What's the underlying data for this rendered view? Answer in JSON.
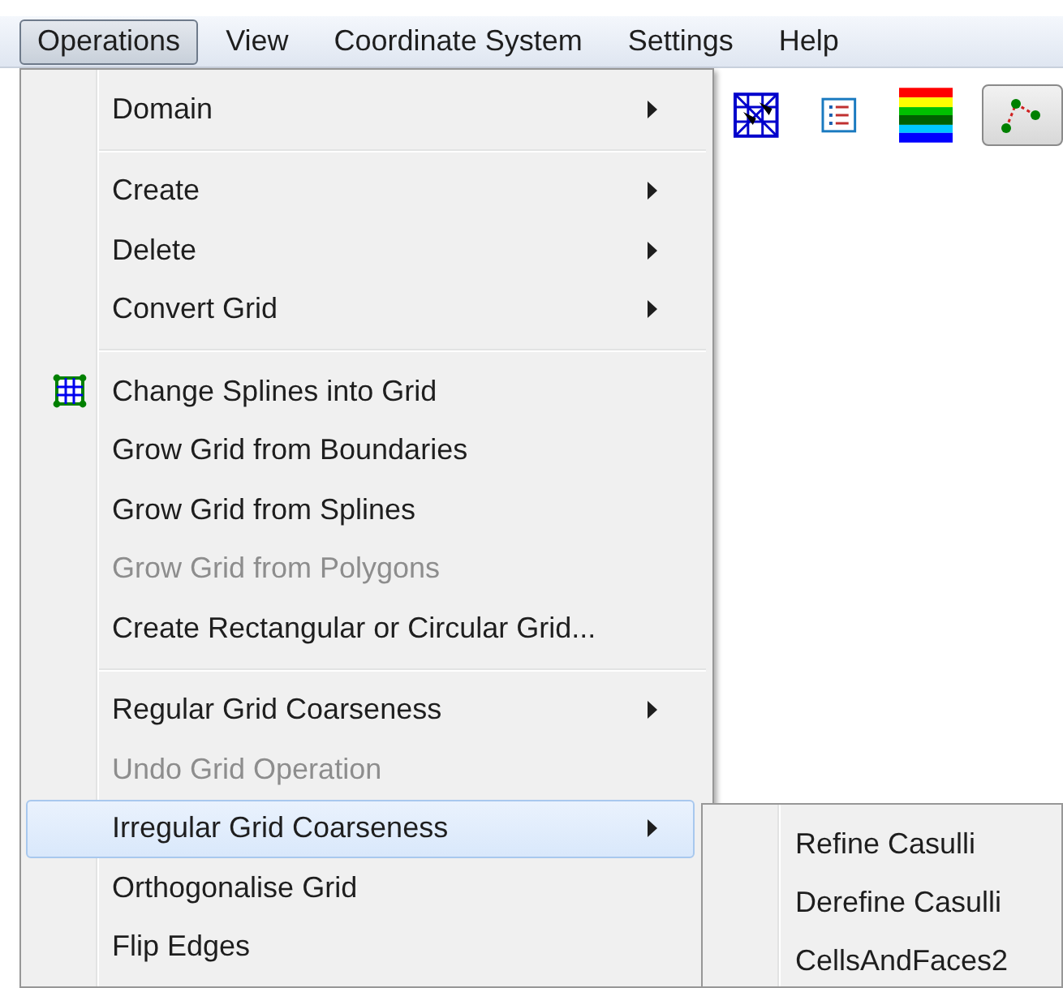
{
  "menubar": [
    {
      "label": "Operations",
      "selected": true
    },
    {
      "label": "View",
      "selected": false
    },
    {
      "label": "Coordinate System",
      "selected": false
    },
    {
      "label": "Settings",
      "selected": false
    },
    {
      "label": "Help",
      "selected": false
    }
  ],
  "menu": [
    {
      "kind": "item",
      "label": "Domain",
      "submenu_arrow": true,
      "disabled": false,
      "selected": false,
      "has_icon": false
    },
    {
      "kind": "separator"
    },
    {
      "kind": "item",
      "label": "Create",
      "submenu_arrow": true,
      "disabled": false,
      "selected": false,
      "has_icon": false
    },
    {
      "kind": "item",
      "label": "Delete",
      "submenu_arrow": true,
      "disabled": false,
      "selected": false,
      "has_icon": false
    },
    {
      "kind": "item",
      "label": "Convert Grid",
      "submenu_arrow": true,
      "disabled": false,
      "selected": false,
      "has_icon": false
    },
    {
      "kind": "separator"
    },
    {
      "kind": "item",
      "label": "Change Splines into Grid",
      "submenu_arrow": false,
      "disabled": false,
      "selected": false,
      "has_icon": true
    },
    {
      "kind": "item",
      "label": "Grow Grid from Boundaries",
      "submenu_arrow": false,
      "disabled": false,
      "selected": false,
      "has_icon": false
    },
    {
      "kind": "item",
      "label": "Grow Grid from Splines",
      "submenu_arrow": false,
      "disabled": false,
      "selected": false,
      "has_icon": false
    },
    {
      "kind": "item",
      "label": "Grow Grid from Polygons",
      "submenu_arrow": false,
      "disabled": true,
      "selected": false,
      "has_icon": false
    },
    {
      "kind": "item",
      "label": "Create Rectangular or Circular Grid...",
      "submenu_arrow": false,
      "disabled": false,
      "selected": false,
      "has_icon": false
    },
    {
      "kind": "separator"
    },
    {
      "kind": "item",
      "label": "Regular Grid Coarseness",
      "submenu_arrow": true,
      "disabled": false,
      "selected": false,
      "has_icon": false
    },
    {
      "kind": "item",
      "label": "Undo Grid Operation",
      "submenu_arrow": false,
      "disabled": true,
      "selected": false,
      "has_icon": false
    },
    {
      "kind": "item",
      "label": "Irregular Grid Coarseness",
      "submenu_arrow": true,
      "disabled": false,
      "selected": true,
      "has_icon": false
    },
    {
      "kind": "item",
      "label": "Orthogonalise Grid",
      "submenu_arrow": false,
      "disabled": false,
      "selected": false,
      "has_icon": false
    },
    {
      "kind": "item",
      "label": "Flip Edges",
      "submenu_arrow": false,
      "disabled": false,
      "selected": false,
      "has_icon": false
    }
  ],
  "submenu": [
    {
      "label": "Refine Casulli"
    },
    {
      "label": "Derefine Casulli"
    },
    {
      "label": "CellsAndFaces2"
    }
  ]
}
